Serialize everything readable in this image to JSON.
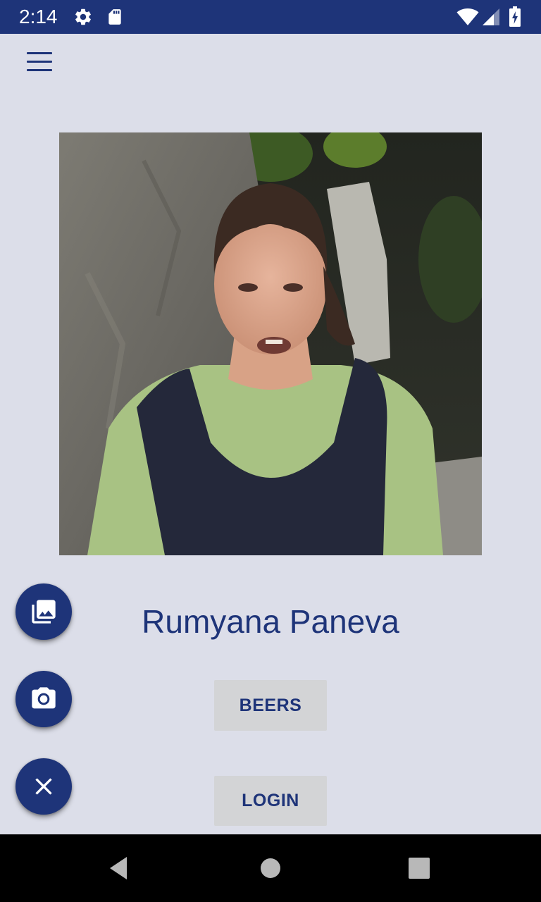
{
  "status_bar": {
    "time": "2:14",
    "background": "#1e3479",
    "icons": [
      "gear-icon",
      "sd-card-icon",
      "wifi-icon",
      "cell-signal-icon",
      "battery-charging-icon"
    ]
  },
  "app": {
    "background": "#dcdee9",
    "accent": "#1e3479",
    "menu_icon": "hamburger-menu-icon"
  },
  "profile": {
    "name": "Rumyana Paneva",
    "photo": "profile-photo"
  },
  "buttons": {
    "beers": "BEERS",
    "login": "LOGIN"
  },
  "fabs": {
    "gallery_icon": "gallery-icon",
    "camera_icon": "camera-icon",
    "close_icon": "close-icon"
  },
  "nav_bar": {
    "background": "#000000",
    "icons": [
      "back-icon",
      "home-icon",
      "recents-icon"
    ]
  }
}
